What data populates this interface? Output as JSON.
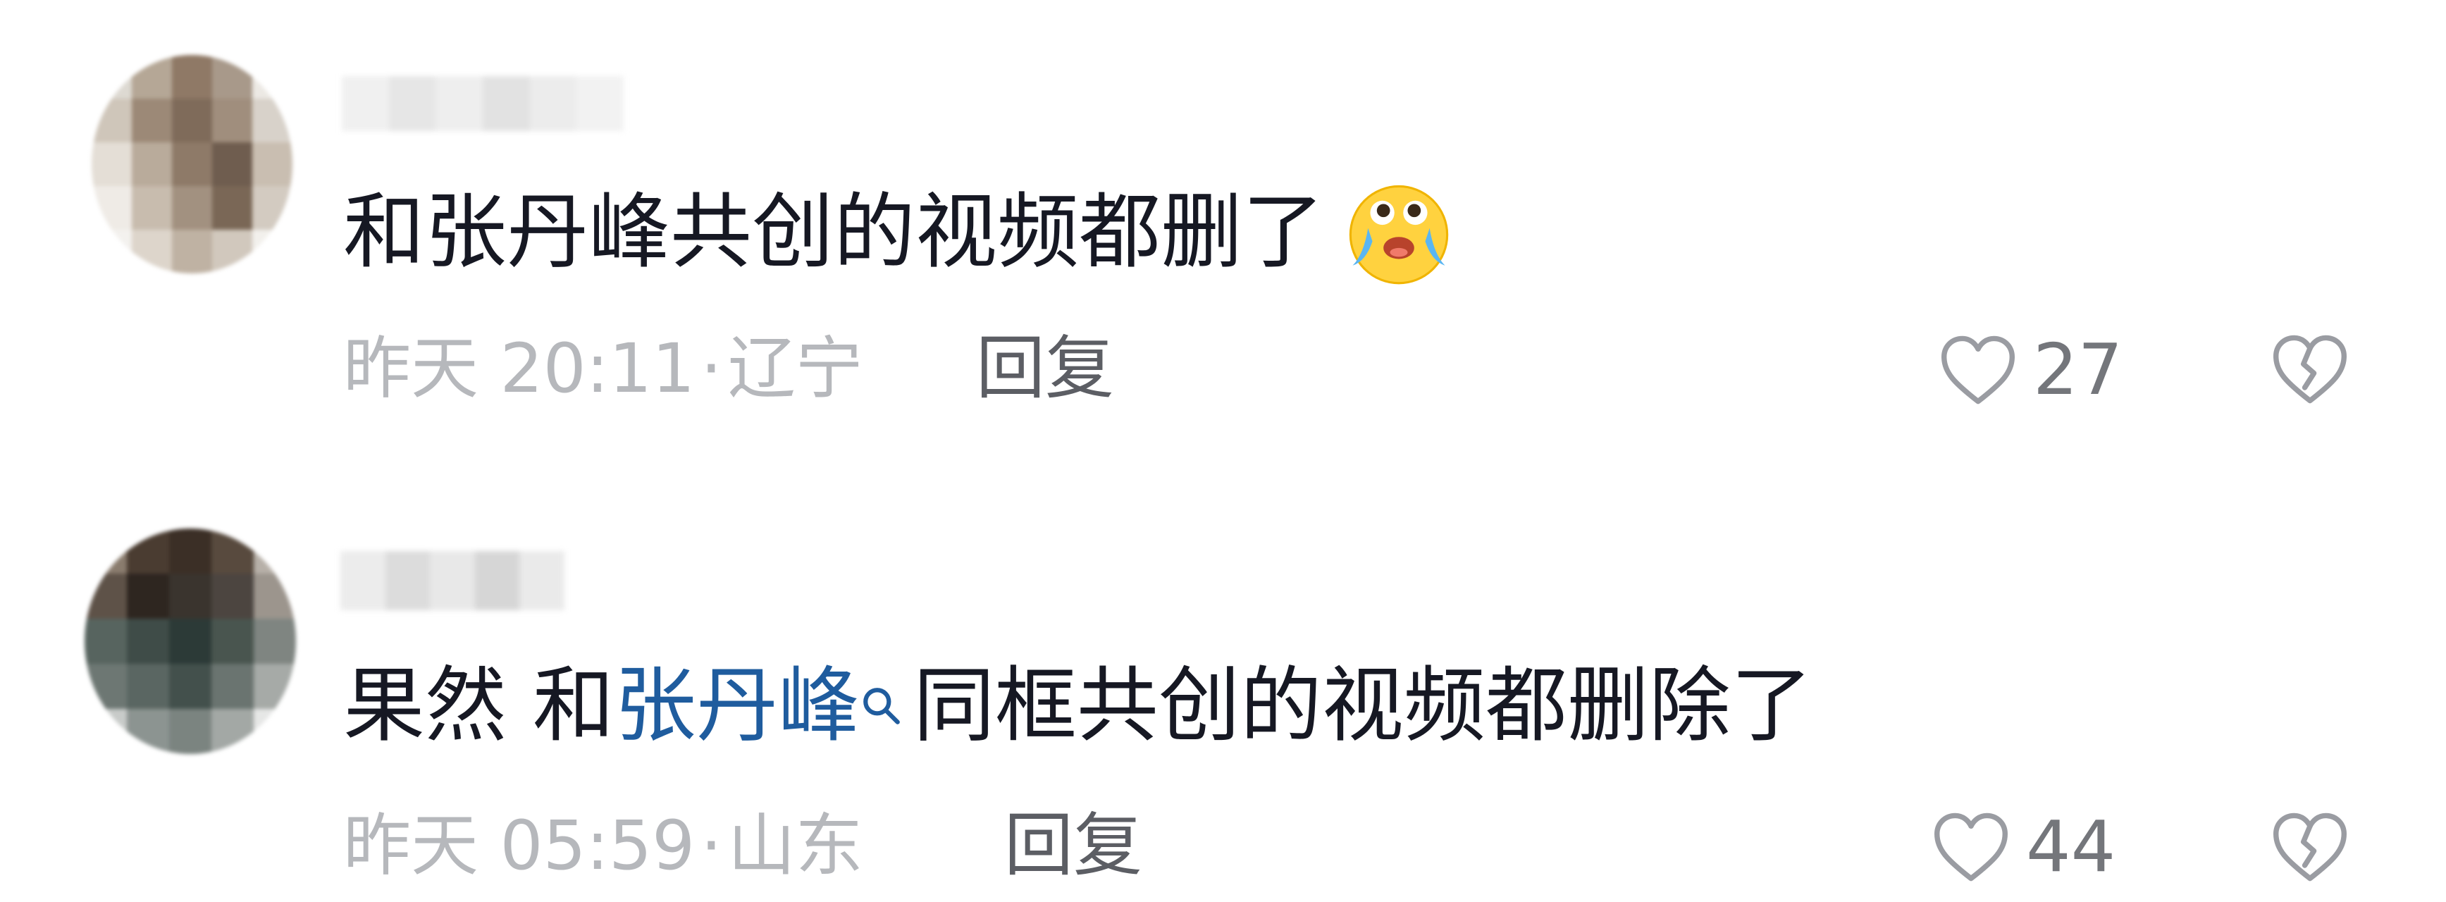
{
  "comments": [
    {
      "text": "和张丹峰共创的视频都删了",
      "emoji": "crying-laughing-emoji",
      "time": "昨天 20:11",
      "location": "辽宁",
      "separator": "·",
      "reply_label": "回复",
      "like_count": "27"
    },
    {
      "text_prefix": "果然 和",
      "mention": "张丹峰",
      "text_suffix": "同框共创的视频都删除了",
      "time": "昨天 05:59",
      "location": "山东",
      "separator": "·",
      "reply_label": "回复",
      "like_count": "44"
    }
  ],
  "icons": {
    "like": "heart-outline-icon",
    "dislike": "broken-heart-icon",
    "mention": "search-icon"
  },
  "colors": {
    "text": "#161823",
    "meta": "#b6b8bc",
    "reply": "#5c5e64",
    "mention": "#1f5c9e",
    "icon": "#9a9ca2"
  }
}
